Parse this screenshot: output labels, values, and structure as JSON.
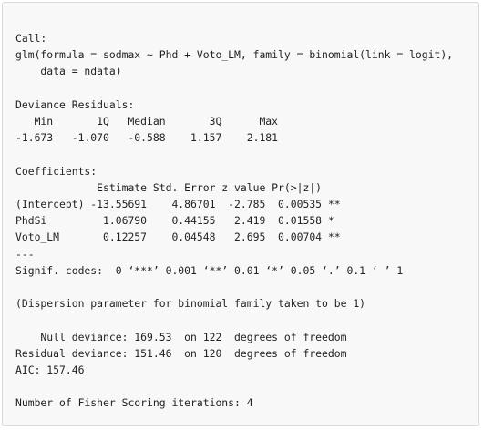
{
  "console": {
    "lines": [
      "Call:",
      "glm(formula = sodmax ~ Phd + Voto_LM, family = binomial(link = logit),",
      "    data = ndata)",
      "",
      "Deviance Residuals:",
      "   Min       1Q   Median       3Q      Max",
      "-1.673   -1.070   -0.588    1.157    2.181",
      "",
      "Coefficients:",
      "             Estimate Std. Error z value Pr(>|z|)",
      "(Intercept) -13.55691    4.86701  -2.785  0.00535 **",
      "PhdSi         1.06790    0.44155   2.419  0.01558 *",
      "Voto_LM       0.12257    0.04548   2.695  0.00704 **",
      "---",
      "Signif. codes:  0 ‘***’ 0.001 ‘**’ 0.01 ‘*’ 0.05 ‘.’ 0.1 ‘ ’ 1",
      "",
      "(Dispersion parameter for binomial family taken to be 1)",
      "",
      "    Null deviance: 169.53  on 122  degrees of freedom",
      "Residual deviance: 151.46  on 120  degrees of freedom",
      "AIC: 157.46",
      "",
      "Number of Fisher Scoring iterations: 4"
    ]
  }
}
